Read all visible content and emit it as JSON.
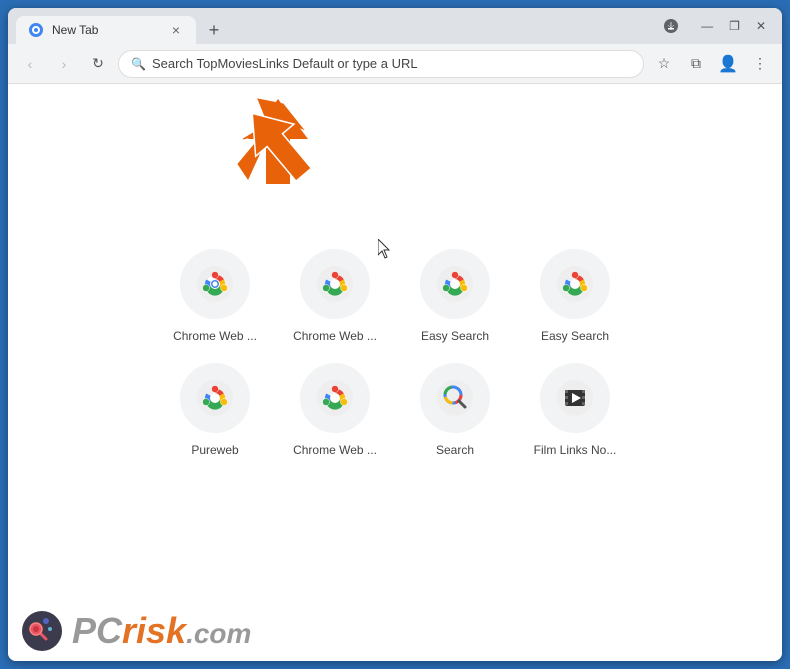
{
  "browser": {
    "tab_title": "New Tab",
    "tab_close": "×",
    "tab_new": "+",
    "window_controls": {
      "minimize": "—",
      "maximize": "❐",
      "close": "✕"
    }
  },
  "toolbar": {
    "back_label": "‹",
    "forward_label": "›",
    "refresh_label": "↻",
    "address_placeholder": "Search TopMoviesLinks Default or type a URL",
    "bookmark_icon": "☆",
    "extensions_icon": "⧉",
    "profile_icon": "○",
    "menu_icon": "⋮",
    "download_icon": "⬇"
  },
  "shortcuts": [
    {
      "label": "Chrome Web ...",
      "icon": "chrome"
    },
    {
      "label": "Chrome Web ...",
      "icon": "chrome"
    },
    {
      "label": "Easy Search",
      "icon": "chrome"
    },
    {
      "label": "Easy Search",
      "icon": "chrome"
    },
    {
      "label": "Pureweb",
      "icon": "chrome"
    },
    {
      "label": "Chrome Web ...",
      "icon": "chrome"
    },
    {
      "label": "Search",
      "icon": "search-color"
    },
    {
      "label": "Film Links No...",
      "icon": "film"
    }
  ],
  "watermark": {
    "text_pc": "PC",
    "text_risk": "risk",
    "text_com": ".com"
  }
}
